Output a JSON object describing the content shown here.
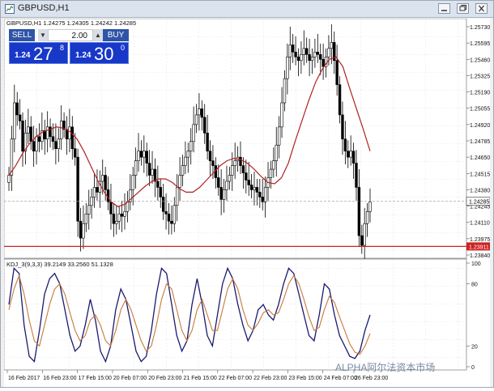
{
  "window": {
    "title": "GBPUSD,H1",
    "controls": [
      "minimize",
      "restore",
      "close"
    ]
  },
  "chart_header": {
    "text": "GBPUSD,H1  1.24275  1.24305  1.24242  1.24285"
  },
  "trade_panel": {
    "sell_label": "SELL",
    "buy_label": "BUY",
    "lot_value": "2.00",
    "sell_price_small": "1.24",
    "sell_price_big": "27",
    "sell_price_sup": "8",
    "buy_price_small": "1.24",
    "buy_price_big": "30",
    "buy_price_sup": "0"
  },
  "colors": {
    "candle": "#000000",
    "moving_average": "#b22222",
    "level_line": "#cc2222",
    "k_line": "#1a1a6e",
    "d_line": "#c77a3a",
    "trade_panel": "#1838c8"
  },
  "chart_data": [
    {
      "type": "candlestick",
      "symbol": "GBPUSD",
      "timeframe": "H1",
      "y_ticks": [
        "1.25730",
        "1.25595",
        "1.25460",
        "1.25325",
        "1.25190",
        "1.25055",
        "1.24920",
        "1.24785",
        "1.24650",
        "1.24515",
        "1.24380",
        "1.24245",
        "1.24110",
        "1.23975",
        "1.23840"
      ],
      "ylim": [
        1.2384,
        1.2573
      ],
      "last_price_label": "1.24285",
      "last_price": 1.24285,
      "level_label": "1.23911",
      "level": 1.23911,
      "x_ticks": [
        "16 Feb 2017",
        "16 Feb 23:00",
        "17 Feb 15:00",
        "20 Feb 07:00",
        "20 Feb 23:00",
        "21 Feb 15:00",
        "22 Feb 07:00",
        "22 Feb 23:00",
        "23 Feb 15:00",
        "24 Feb 07:00",
        "26 Feb 23:00"
      ],
      "closes_approx": [
        1.245,
        1.248,
        1.251,
        1.25,
        1.2495,
        1.247,
        1.2485,
        1.249,
        1.2478,
        1.247,
        1.2482,
        1.2478,
        1.2487,
        1.248,
        1.249,
        1.2482,
        1.2478,
        1.2472,
        1.248,
        1.2495,
        1.2488,
        1.248,
        1.249,
        1.2472,
        1.2465,
        1.2412,
        1.2398,
        1.241,
        1.2418,
        1.2425,
        1.2432,
        1.244,
        1.2436,
        1.2445,
        1.245,
        1.2438,
        1.2428,
        1.2418,
        1.241,
        1.2412,
        1.2418,
        1.2416,
        1.242,
        1.2428,
        1.2438,
        1.245,
        1.2462,
        1.247,
        1.2465,
        1.247,
        1.246,
        1.245,
        1.2455,
        1.2445,
        1.244,
        1.2432,
        1.242,
        1.2418,
        1.2412,
        1.241,
        1.2425,
        1.244,
        1.245,
        1.2458,
        1.2465,
        1.247,
        1.2478,
        1.2492,
        1.25,
        1.2505,
        1.2498,
        1.2485,
        1.247,
        1.2462,
        1.2458,
        1.2448,
        1.244,
        1.243,
        1.2438,
        1.2445,
        1.245,
        1.2458,
        1.2462,
        1.2465,
        1.2458,
        1.2452,
        1.2446,
        1.2442,
        1.2438,
        1.244,
        1.2436,
        1.2432,
        1.2428,
        1.244,
        1.2448,
        1.2455,
        1.2462,
        1.2475,
        1.249,
        1.251,
        1.253,
        1.2548,
        1.2558,
        1.2552,
        1.2548,
        1.2545,
        1.255,
        1.2555,
        1.255,
        1.2545,
        1.2548,
        1.2552,
        1.255,
        1.2546,
        1.254,
        1.2548,
        1.2555,
        1.256,
        1.2545,
        1.2525,
        1.25,
        1.248,
        1.247,
        1.2465,
        1.247,
        1.246,
        1.244,
        1.24,
        1.2392,
        1.241,
        1.242,
        1.2428
      ],
      "moving_average_approx": [
        1.245,
        1.2458,
        1.2468,
        1.2476,
        1.2482,
        1.2486,
        1.2488,
        1.249,
        1.2489,
        1.2486,
        1.248,
        1.247,
        1.2458,
        1.2446,
        1.2436,
        1.2428,
        1.2424,
        1.2426,
        1.2431,
        1.2436,
        1.2441,
        1.2445,
        1.2447,
        1.2447,
        1.2444,
        1.2439,
        1.2436,
        1.2436,
        1.244,
        1.2446,
        1.2452,
        1.2458,
        1.2462,
        1.2464,
        1.2463,
        1.246,
        1.2455,
        1.2449,
        1.2444,
        1.2443,
        1.2448,
        1.246,
        1.2478,
        1.2495,
        1.2512,
        1.2527,
        1.2538,
        1.2546,
        1.2548,
        1.254,
        1.2522,
        1.2505,
        1.2488,
        1.247
      ]
    },
    {
      "type": "line",
      "indicator": "KDJ_3",
      "header": "KDJ_3(9,3,3) 39.2149 33.2560 51.1328",
      "ylim": [
        0,
        100
      ],
      "y_ticks": [
        "100",
        "80",
        "20",
        "0"
      ],
      "series": [
        {
          "values": [
            60,
            95,
            90,
            40,
            10,
            5,
            35,
            70,
            85,
            90,
            80,
            55,
            30,
            15,
            20,
            40,
            65,
            45,
            15,
            5,
            20,
            55,
            75,
            65,
            40,
            15,
            5,
            10,
            35,
            70,
            95,
            90,
            60,
            30,
            15,
            25,
            60,
            85,
            60,
            30,
            20,
            50,
            80,
            95,
            85,
            60,
            40,
            25,
            35,
            55,
            60,
            50,
            45,
            60,
            80,
            95,
            90,
            70,
            50,
            30,
            25,
            50,
            80,
            75,
            50,
            30,
            20,
            10,
            8,
            15,
            35,
            50
          ]
        },
        {
          "values": [
            55,
            75,
            88,
            70,
            45,
            25,
            20,
            40,
            60,
            75,
            80,
            70,
            52,
            35,
            25,
            30,
            45,
            50,
            40,
            25,
            20,
            35,
            55,
            65,
            55,
            40,
            25,
            15,
            20,
            40,
            65,
            80,
            75,
            55,
            35,
            25,
            35,
            55,
            65,
            50,
            35,
            35,
            55,
            75,
            85,
            75,
            55,
            40,
            35,
            42,
            52,
            55,
            50,
            52,
            65,
            80,
            88,
            80,
            65,
            48,
            35,
            38,
            55,
            68,
            62,
            48,
            35,
            22,
            14,
            12,
            20,
            32
          ]
        }
      ]
    }
  ],
  "watermark": {
    "text": "ALPHA阿尔法资本市场"
  }
}
